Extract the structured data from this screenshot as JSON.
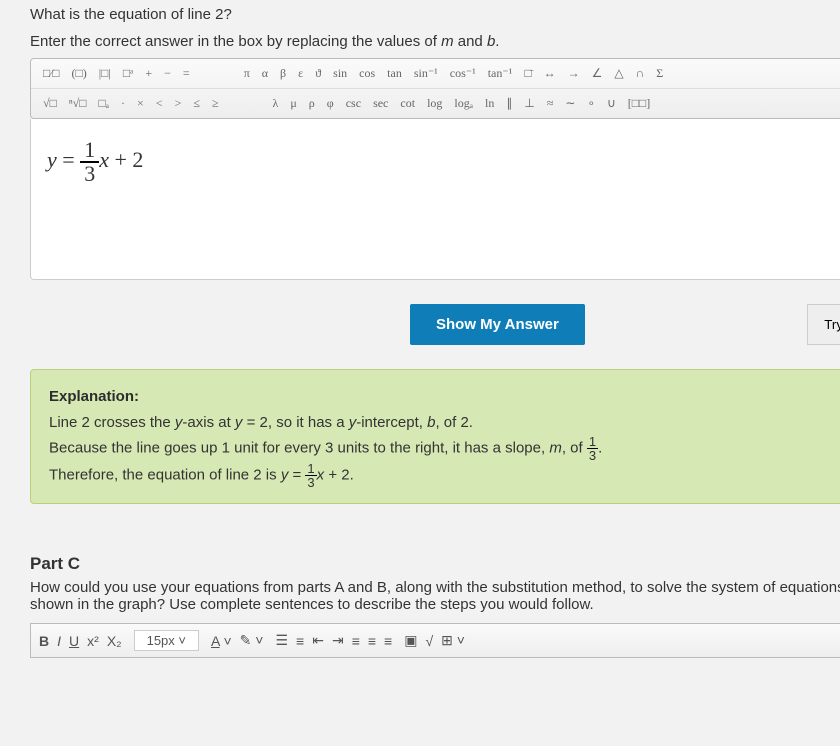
{
  "question": {
    "line1": "What is the equation of line 2?",
    "line2_pre": "Enter the correct answer in the box by replacing the values of ",
    "line2_m": "m",
    "line2_mid": " and ",
    "line2_b": "b",
    "line2_end": "."
  },
  "math_toolbar": {
    "r1": [
      "□⁄□",
      "(□)",
      "|□|",
      "□ᵃ",
      "+",
      "−",
      "=",
      "",
      "π",
      "α",
      "β",
      "ε",
      "ϑ",
      "sin",
      "cos",
      "tan",
      "sin⁻¹",
      "cos⁻¹",
      "tan⁻¹",
      "□̄",
      "↔",
      "→",
      "∠",
      "△",
      "∩",
      "Σ"
    ],
    "r2": [
      "√□",
      "ⁿ√□",
      "□ₐ",
      "·",
      "×",
      "<",
      ">",
      "≤",
      "≥",
      "",
      "λ",
      "μ",
      "ρ",
      "φ",
      "csc",
      "sec",
      "cot",
      "log",
      "logₐ",
      "ln",
      "∥",
      "⊥",
      "≈",
      "∼",
      "∘",
      "∪",
      "[□□]"
    ]
  },
  "editor": {
    "y": "y",
    "eq": " = ",
    "num": "1",
    "den": "3",
    "x": "x",
    "plus": " + ",
    "b": "2"
  },
  "actions": {
    "show": "Show My Answer",
    "try": "Try"
  },
  "expl": {
    "title": "Explanation:",
    "p1_a": "Line 2 crosses the ",
    "p1_b": "y",
    "p1_c": "-axis at ",
    "p1_d": "y",
    "p1_e": " = 2, so it has a ",
    "p1_f": "y",
    "p1_g": "-intercept, ",
    "p1_h": "b",
    "p1_i": ", of 2.",
    "p2_a": "Because the line goes up 1 unit for every 3 units to the right, it has a slope, ",
    "p2_b": "m",
    "p2_c": ", of ",
    "p2_num": "1",
    "p2_den": "3",
    "p2_d": ".",
    "p3_a": "Therefore, the equation of line 2 is ",
    "p3_b": "y",
    "p3_c": " = ",
    "p3_num": "1",
    "p3_den": "3",
    "p3_d": "x",
    "p3_e": " + 2."
  },
  "partc": {
    "title": "Part C",
    "text": "How could you use your equations from parts A and B, along with the substitution method, to solve the system of equations shown in the graph? Use complete sentences to describe the steps you would follow."
  },
  "rte": {
    "b": "B",
    "i": "I",
    "u": "U",
    "sup": "x²",
    "sub": "X₂",
    "size": "15px",
    "a": "A",
    "pen": "✎",
    "ul": "☰",
    "ol": "≡",
    "out": "⇤",
    "in": "⇥",
    "l": "≡",
    "c": "≡",
    "r": "≡",
    "img": "▣",
    "sq": "√",
    "tbl": "⊞"
  }
}
